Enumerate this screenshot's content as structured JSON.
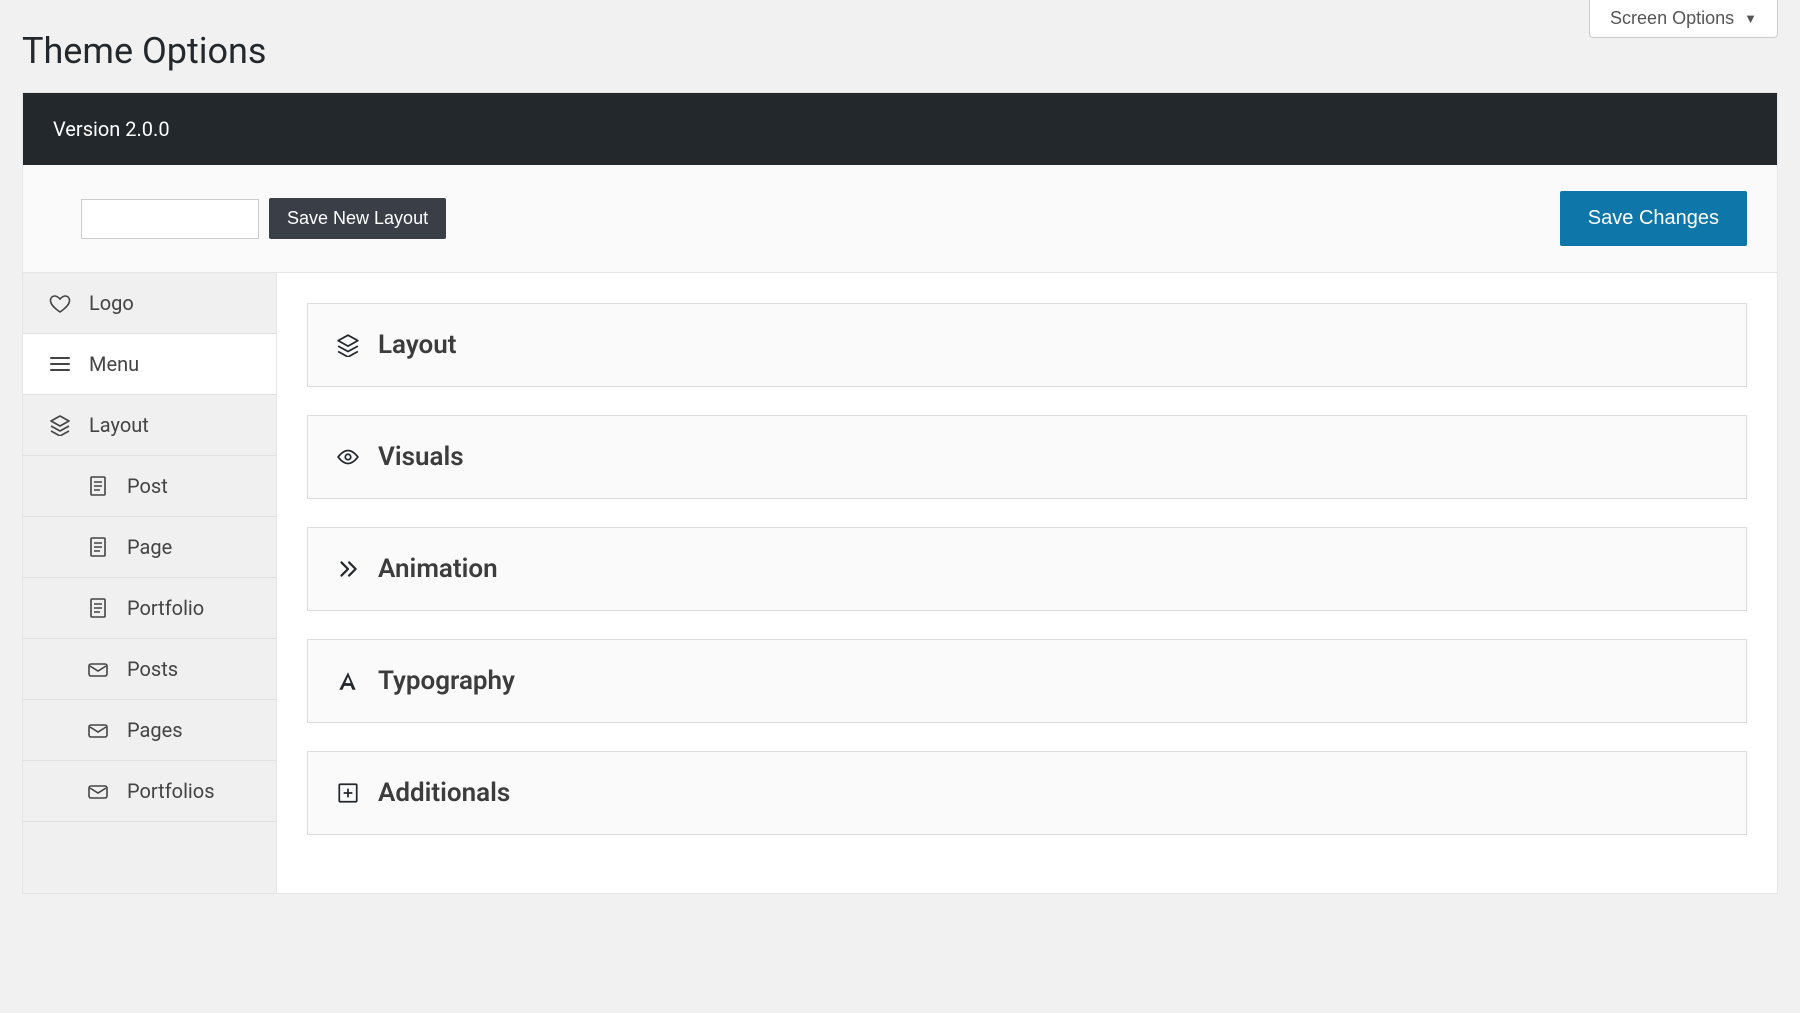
{
  "screen_options_label": "Screen Options",
  "page_title": "Theme Options",
  "version_label": "Version 2.0.0",
  "toolbar": {
    "layout_name_value": "",
    "layout_name_placeholder": "",
    "save_new_layout_label": "Save New Layout",
    "save_changes_label": "Save Changes"
  },
  "sidebar": {
    "items": [
      {
        "label": "Logo",
        "icon": "heart"
      },
      {
        "label": "Menu",
        "icon": "menu",
        "active": true
      },
      {
        "label": "Layout",
        "icon": "layers"
      }
    ],
    "sub_items": [
      {
        "label": "Post",
        "icon": "doc"
      },
      {
        "label": "Page",
        "icon": "doc"
      },
      {
        "label": "Portfolio",
        "icon": "doc"
      },
      {
        "label": "Posts",
        "icon": "mail"
      },
      {
        "label": "Pages",
        "icon": "mail"
      },
      {
        "label": "Portfolios",
        "icon": "mail"
      }
    ]
  },
  "panels": [
    {
      "label": "Layout",
      "icon": "layers"
    },
    {
      "label": "Visuals",
      "icon": "eye"
    },
    {
      "label": "Animation",
      "icon": "chevrons"
    },
    {
      "label": "Typography",
      "icon": "font"
    },
    {
      "label": "Additionals",
      "icon": "plus-square"
    }
  ]
}
